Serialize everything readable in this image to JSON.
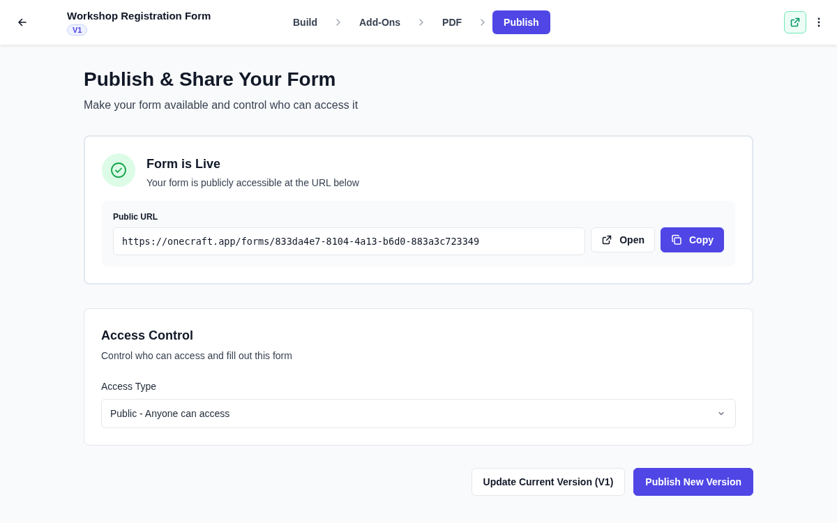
{
  "header": {
    "title": "Workshop Registration Form",
    "version_badge": "V1"
  },
  "steps": [
    {
      "label": "Build",
      "selected": false
    },
    {
      "label": "Add-Ons",
      "selected": false
    },
    {
      "label": "PDF",
      "selected": false
    },
    {
      "label": "Publish",
      "selected": true
    }
  ],
  "page": {
    "title": "Publish & Share Your Form",
    "subtitle": "Make your form available and control who can access it"
  },
  "status": {
    "live": true,
    "title": "Form is Live",
    "description": "Your form is publicly accessible at the URL below"
  },
  "public_url": {
    "label": "Public URL",
    "value": "https://onecraft.app/forms/833da4e7-8104-4a13-b6d0-883a3c723349",
    "open_button": "Open",
    "copy_button": "Copy"
  },
  "access_control": {
    "title": "Access Control",
    "description": "Control who can access and fill out this form",
    "field_label": "Access Type",
    "value": "Public - Anyone can access"
  },
  "actions": [
    "Update Current Version (V1)",
    "Publish New Version"
  ]
}
